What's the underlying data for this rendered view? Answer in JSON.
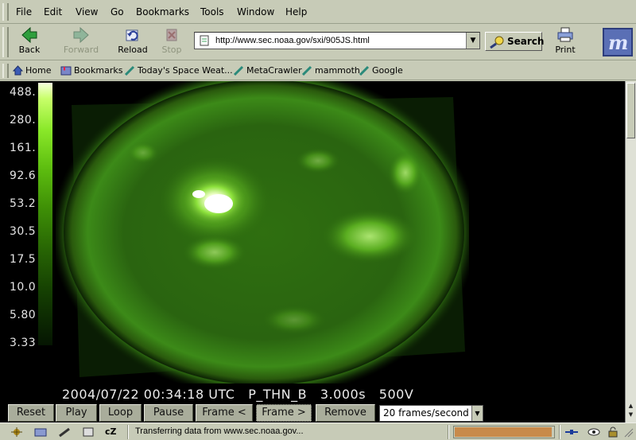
{
  "menubar": {
    "items": [
      "File",
      "Edit",
      "View",
      "Go",
      "Bookmarks",
      "Tools",
      "Window",
      "Help"
    ]
  },
  "toolbar": {
    "back_label": "Back",
    "forward_label": "Forward",
    "reload_label": "Reload",
    "stop_label": "Stop",
    "print_label": "Print",
    "search_label": "Search"
  },
  "urlbar": {
    "url": "http://www.sec.noaa.gov/sxi/905JS.html"
  },
  "personal_toolbar": {
    "items": [
      "Home",
      "Bookmarks",
      "Today's Space Weat...",
      "MetaCrawler",
      "mammoth",
      "Google"
    ]
  },
  "viewer": {
    "colorbar_labels": [
      "488.",
      "280.",
      "161.",
      "92.6",
      "53.2",
      "30.5",
      "17.5",
      "10.0",
      "5.80",
      "3.33"
    ],
    "caption": "2004/07/22 00:34:18 UTC   P_THN_B   3.000s   500V",
    "buttons": [
      "Reset",
      "Play",
      "Loop",
      "Pause",
      "Frame <",
      "Frame >",
      "Remove"
    ],
    "speed_select": "20 frames/second"
  },
  "statusbar": {
    "text": "Transferring data from www.sec.noaa.gov...",
    "progress": 0.98
  },
  "colors": {
    "chrome": "#c7cbb7",
    "progress_fill": "#c88a4a",
    "sun_green": "#4fbf1c"
  }
}
